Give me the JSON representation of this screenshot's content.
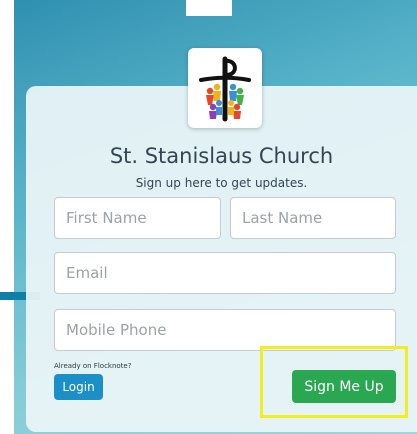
{
  "page": {
    "background_color": "#57b3c9",
    "card_color": "#ecf5f7"
  },
  "header": {
    "logo_icon": "cross-with-children-icon",
    "title": "St. Stanislaus Church",
    "subtitle": "Sign up here to get updates."
  },
  "form": {
    "first_name": {
      "placeholder": "First Name",
      "value": ""
    },
    "last_name": {
      "placeholder": "Last Name",
      "value": ""
    },
    "email": {
      "placeholder": "Email",
      "value": ""
    },
    "mobile_phone": {
      "placeholder": "Mobile Phone",
      "value": ""
    }
  },
  "footer": {
    "already_label": "Already on Flocknote?",
    "login_label": "Login",
    "signup_label": "Sign Me Up"
  },
  "colors": {
    "login_button": "#1b8fc7",
    "signup_button": "#2aa751",
    "highlight_box": "#f2ee1b",
    "title_text": "#344554"
  }
}
